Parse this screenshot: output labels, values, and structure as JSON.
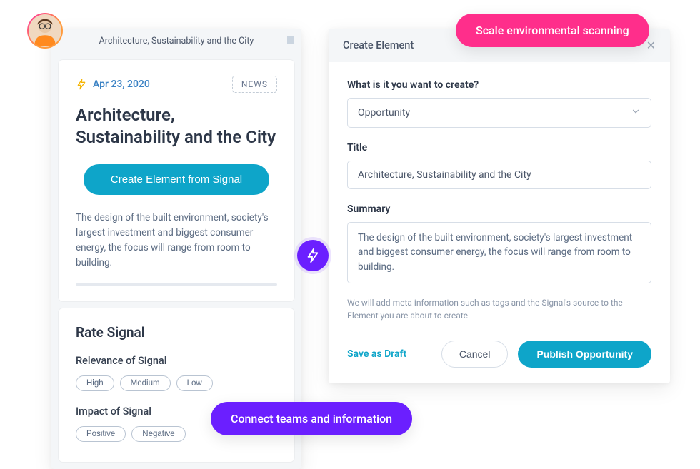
{
  "avatar": {},
  "panel_left": {
    "header_title": "Architecture, Sustainability and the City",
    "date": "Apr 23, 2020",
    "tag": "NEWS",
    "title": "Architecture, Sustainability and the City",
    "create_btn": "Create Element from Signal",
    "body": "The design of the built environment, society's largest investment and biggest consumer energy, the focus will range from room to building."
  },
  "rate": {
    "heading": "Rate Signal",
    "relevance_label": "Relevance of Signal",
    "relevance_options": [
      "High",
      "Medium",
      "Low"
    ],
    "impact_label": "Impact of Signal",
    "impact_options": [
      "Positive",
      "Negative"
    ]
  },
  "panel_right": {
    "header": "Create Element",
    "q1_label": "What is it you want to create?",
    "q1_value": "Opportunity",
    "title_label": "Title",
    "title_value": "Architecture, Sustainability and the City",
    "summary_label": "Summary",
    "summary_value": "The design of the built environment, society's largest investment and biggest consumer energy, the focus will range from room to building.",
    "meta_note": "We will add meta information such as tags and the Signal's source to the Element you are about to create.",
    "save_draft": "Save as Draft",
    "cancel": "Cancel",
    "publish": "Publish Opportunity"
  },
  "pills": {
    "pink": "Scale environmental scanning",
    "purple": "Connect teams and information"
  }
}
